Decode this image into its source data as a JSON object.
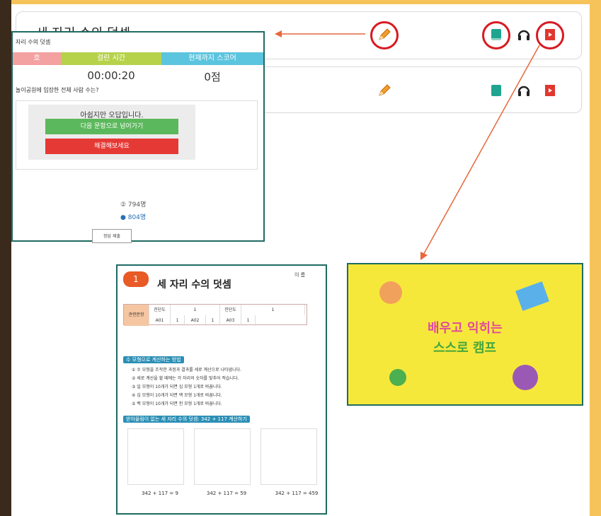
{
  "cards": [
    {
      "title": "세 자리 수의 덧셈"
    }
  ],
  "popup": {
    "sub": "자리 수의 덧셈",
    "headers": [
      "호",
      "걸린 시간",
      "현재까지 스코어"
    ],
    "time": "00:00:20",
    "score": "0점",
    "question": "놀이공원에 입장한 전체 사람 수는?",
    "message": "아쉽지만 오답입니다.",
    "btn_next": "다음 문항으로 넘어가기",
    "btn_solve": "해결해보세요",
    "options": [
      "② 794명",
      "● 804명"
    ],
    "check": "정답 제출"
  },
  "worksheet": {
    "chapter": "1",
    "title": "세 자리 수의 덧셈",
    "name": "이 름",
    "table_label": "관련문항",
    "cells": [
      "진단도",
      "1",
      "진단도",
      "1",
      "A01",
      "1",
      "A02",
      "1",
      "A03",
      "1"
    ],
    "section1": "수 모형으로 계산하는 방법",
    "lines": [
      "① 수 모형을 조작한 과정과 결과를 세로 계산으로 나타냅니다.",
      "② 세로 계산을 할 때에는 각 자리의 숫자를 맞추어 적습니다.",
      "③ 일 모형이 10개가 되면 십 모형 1개로 바꿉니다.",
      "④ 십 모형이 10개가 되면 백 모형 1개로 바꿉니다.",
      "⑤ 백 모형이 10개가 되면 천 모형 1개로 바꿉니다."
    ],
    "section2": "받아올림이 없는 세 자리 수의 덧셈: 342 + 117 계산하기",
    "eqs": [
      "342 + 117 = 9",
      "342 + 117 = 59",
      "342 + 117 = 459"
    ]
  },
  "banner": {
    "line1": "배우고 익히는",
    "line2": "스스로 캠프"
  },
  "colors": {
    "frame": "#f6c35b",
    "accent_red": "#d71a21",
    "border_green": "#1f6b62",
    "btn_green": "#5cb85c",
    "btn_red": "#e53935"
  },
  "icons": [
    "pencil-icon",
    "book-icon",
    "headphones-icon",
    "video-icon"
  ]
}
